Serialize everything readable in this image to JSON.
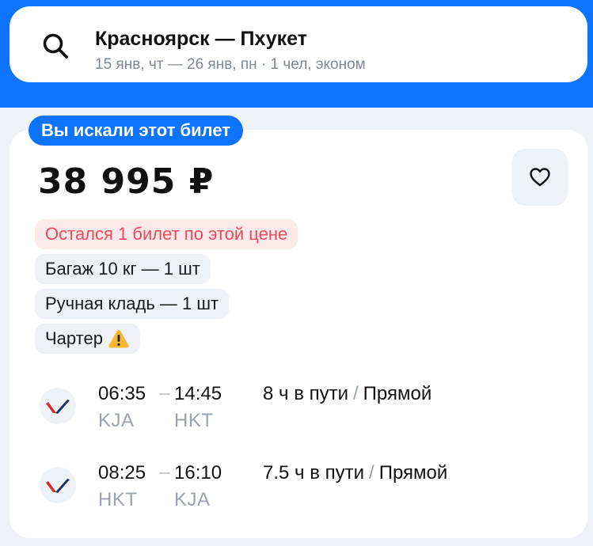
{
  "search": {
    "route": "Красноярск — Пхукет",
    "details": "15 янв, чт — 26 янв, пн · 1 чел, эконом"
  },
  "ticket": {
    "badge": "Вы искали этот билет",
    "price": "38 995 ₽",
    "chips": {
      "seats_left": "Остался 1 билет по этой цене",
      "baggage": "Багаж 10 кг — 1 шт",
      "hand_luggage": "Ручная кладь — 1 шт",
      "charter": "Чартер"
    },
    "segments": [
      {
        "depart_time": "06:35",
        "arrive_time": "14:45",
        "depart_code": "KJA",
        "arrive_code": "HKT",
        "duration": "8 ч в пути",
        "separator": "/",
        "stops": "Прямой"
      },
      {
        "depart_time": "08:25",
        "arrive_time": "16:10",
        "depart_code": "HKT",
        "arrive_code": "KJA",
        "duration": "7.5 ч в пути",
        "separator": "/",
        "stops": "Прямой"
      }
    ]
  },
  "colors": {
    "accent": "#0c73fe",
    "warning_red": "#ea4b5c",
    "warning_yellow": "#f7b733"
  },
  "icons": [
    "search-icon",
    "heart-icon",
    "warning-icon",
    "airline-logo-icon"
  ]
}
